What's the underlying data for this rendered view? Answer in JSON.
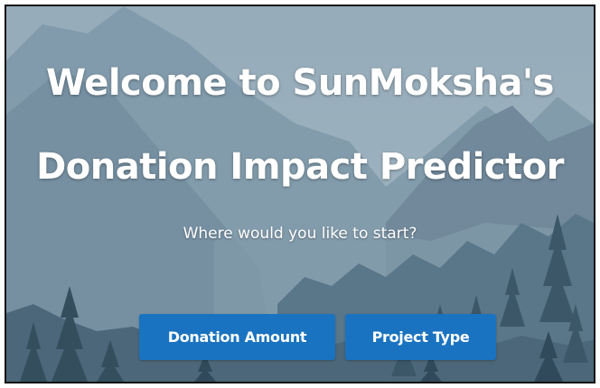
{
  "hero": {
    "title_line1": "Welcome to SunMoksha's",
    "title_line2": "Donation Impact Predictor",
    "prompt": "Where would you like to start?"
  },
  "actions": {
    "donation_amount_label": "Donation Amount",
    "project_type_label": "Project Type"
  },
  "colors": {
    "button_bg": "#1a73c0",
    "text": "#ffffff"
  }
}
